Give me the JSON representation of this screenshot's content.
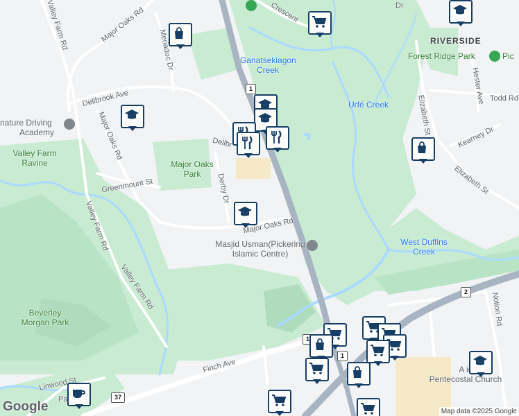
{
  "map": {
    "colors": {
      "background": "#f1f3f4",
      "park": "#c8ebd2",
      "park_dark": "#aedcbc",
      "water": "#aadaff",
      "highway": "#a8b4c2",
      "road": "#ffffff",
      "marker_border": "#173f66",
      "marker_icon": "#173f66"
    },
    "neighbourhood_labels": [
      "RIVERSIDE"
    ],
    "park_labels": [
      "Major Oaks Park",
      "Valley Farm Ravine",
      "Beverley Morgan Park",
      "Forest Ridge Park"
    ],
    "water_labels": [
      "Ganatsekiagon Creek",
      "Urfé Creek",
      "West Duffins Creek"
    ],
    "street_labels": {
      "valley_farm_rd_top": "Valley Farm Rd",
      "major_oaks_rd_top": "Major Oaks Rd",
      "meriadoc_dr": "Meriadoc Dr",
      "dellbrook_ave": "Dellbrook Ave",
      "major_oaks_rd_mid": "Major Oaks Rd",
      "dellbrook_short": "Dellbr",
      "greenmount_st": "Greenmount St",
      "derby_dr": "Derby Dr",
      "valley_farm_rd_mid": "Valley Farm Rd",
      "major_oaks_rd_bottom": "Major Oaks Rd",
      "valley_farm_rd_bottom": "Valley Farm Rd",
      "finch_ave": "Finch Ave",
      "linwood_st": "Linwood St",
      "pa_partial": "Pa",
      "crescent": "Crescent",
      "elizabeth_st_upper": "Elizabeth St",
      "elizabeth_st_lower": "Elizabeth St",
      "hester_ave": "Hester Ave",
      "todd_rd": "Todd Rd",
      "kearney_dr": "Kearney Dr",
      "notion_rd": "Notion Rd",
      "dr_partial": "Dr"
    },
    "poi_labels": {
      "driving_academy_line1": "nature Driving",
      "driving_academy_line2": "Academy",
      "masjid_line1": "Masjid Usman(Pickering",
      "masjid_line2": "Islamic Centre)",
      "church_line1": "A        ic",
      "church_line2": "Pentecostal Church",
      "forest_ridge_prefix": "Pic"
    },
    "highway_shields": [
      "1",
      "1",
      "1",
      "2",
      "37"
    ],
    "markers": [
      {
        "id": "m1",
        "icon": "shopping-bag-icon"
      },
      {
        "id": "m2",
        "icon": "school-icon"
      },
      {
        "id": "m3",
        "icon": "shopping-cart-icon"
      },
      {
        "id": "m4",
        "icon": "school-icon"
      },
      {
        "id": "m5",
        "icon": "school-icon"
      },
      {
        "id": "m6",
        "icon": "school-icon"
      },
      {
        "id": "m7",
        "icon": "restaurant-icon"
      },
      {
        "id": "m8",
        "icon": "restaurant-icon"
      },
      {
        "id": "m9",
        "icon": "restaurant-icon"
      },
      {
        "id": "m10",
        "icon": "shopping-bag-icon"
      },
      {
        "id": "m11",
        "icon": "school-icon"
      },
      {
        "id": "m12",
        "icon": "shopping-cart-icon"
      },
      {
        "id": "m13",
        "icon": "shopping-bag-icon"
      },
      {
        "id": "m14",
        "icon": "shopping-cart-icon"
      },
      {
        "id": "m15",
        "icon": "shopping-cart-icon"
      },
      {
        "id": "m16",
        "icon": "shopping-cart-icon"
      },
      {
        "id": "m17",
        "icon": "shopping-cart-icon"
      },
      {
        "id": "m18",
        "icon": "shopping-bag-icon"
      },
      {
        "id": "m19",
        "icon": "school-icon"
      },
      {
        "id": "m20",
        "icon": "shopping-cart-icon"
      },
      {
        "id": "m21",
        "icon": "shopping-cart-icon"
      },
      {
        "id": "m22",
        "icon": "cafe-icon"
      },
      {
        "id": "m23",
        "icon": "shopping-cart-icon"
      }
    ],
    "attribution": "Map data ©2025 Google",
    "logo": "Google"
  }
}
